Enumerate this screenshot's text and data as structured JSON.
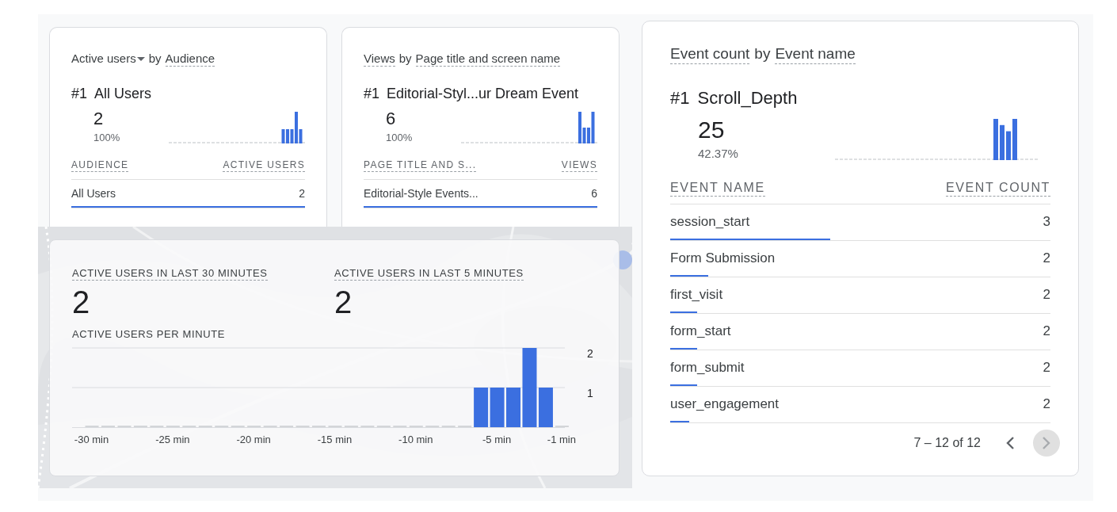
{
  "cards": [
    {
      "title": {
        "metric": "Active users",
        "metric_dropdown": true,
        "by": "by",
        "dimension": "Audience"
      },
      "top": {
        "rank": "#1",
        "name": "All Users",
        "value": "2",
        "share": "100%"
      },
      "columns": [
        "AUDIENCE",
        "ACTIVE USERS"
      ],
      "rows": [
        {
          "label": "All Users",
          "value": "2",
          "level": 1
        }
      ]
    },
    {
      "title": {
        "metric": "Views",
        "metric_dropdown": false,
        "by": "by",
        "dimension": "Page title and screen name"
      },
      "top": {
        "rank": "#1",
        "name": "Editorial-Styl...ur Dream Event",
        "value": "6",
        "share": "100%"
      },
      "columns": [
        "PAGE TITLE AND S...",
        "VIEWS"
      ],
      "rows": [
        {
          "label": "Editorial-Style Events...",
          "value": "6",
          "level": 1
        }
      ]
    },
    {
      "title": {
        "metric": "Event count",
        "metric_dropdown": false,
        "by": "by",
        "dimension": "Event name"
      },
      "top": {
        "rank": "#1",
        "name": "Scroll_Depth",
        "value": "25",
        "share": "42.37%"
      },
      "columns": [
        "EVENT NAME",
        "EVENT COUNT"
      ],
      "rows": [
        {
          "label": "session_start",
          "value": "3",
          "level": 0.42
        },
        {
          "label": "Form Submission",
          "value": "2",
          "level": 0.1
        },
        {
          "label": "first_visit",
          "value": "2",
          "level": 0.07
        },
        {
          "label": "form_start",
          "value": "2",
          "level": 0.07
        },
        {
          "label": "form_submit",
          "value": "2",
          "level": 0.07
        },
        {
          "label": "user_engagement",
          "value": "2",
          "level": 0.05
        }
      ],
      "pagination": {
        "label": "7 – 12 of 12",
        "prev": {
          "disabled": false
        },
        "next": {
          "disabled": true
        }
      }
    }
  ],
  "realtime": {
    "stats": [
      {
        "label": "ACTIVE USERS IN LAST 30 MINUTES",
        "value": "2"
      },
      {
        "label": "ACTIVE USERS IN LAST 5 MINUTES",
        "value": "2"
      }
    ],
    "chart_label": "ACTIVE USERS PER MINUTE",
    "chart_data": {
      "type": "bar",
      "x": [
        -30,
        -29,
        -28,
        -27,
        -26,
        -25,
        -24,
        -23,
        -22,
        -21,
        -20,
        -19,
        -18,
        -17,
        -16,
        -15,
        -14,
        -13,
        -12,
        -11,
        -10,
        -9,
        -8,
        -7,
        -6,
        -5,
        -4,
        -3,
        -2,
        -1
      ],
      "values": [
        0,
        0,
        0,
        0,
        0,
        0,
        0,
        0,
        0,
        0,
        0,
        0,
        0,
        0,
        0,
        0,
        0,
        0,
        0,
        0,
        0,
        0,
        0,
        0,
        1,
        1,
        1,
        2,
        1,
        0
      ],
      "xlim": [
        -31.2,
        -0.8
      ],
      "ylim": [
        0,
        2
      ],
      "yticks": [
        1,
        2
      ],
      "xticks": [
        {
          "value": -30,
          "label": "-30 min"
        },
        {
          "value": -25,
          "label": "-25 min"
        },
        {
          "value": -20,
          "label": "-20 min"
        },
        {
          "value": -15,
          "label": "-15 min"
        },
        {
          "value": -10,
          "label": "-10 min"
        },
        {
          "value": -5,
          "label": "-5 min"
        },
        {
          "value": -1,
          "label": "-1 min"
        }
      ]
    }
  }
}
